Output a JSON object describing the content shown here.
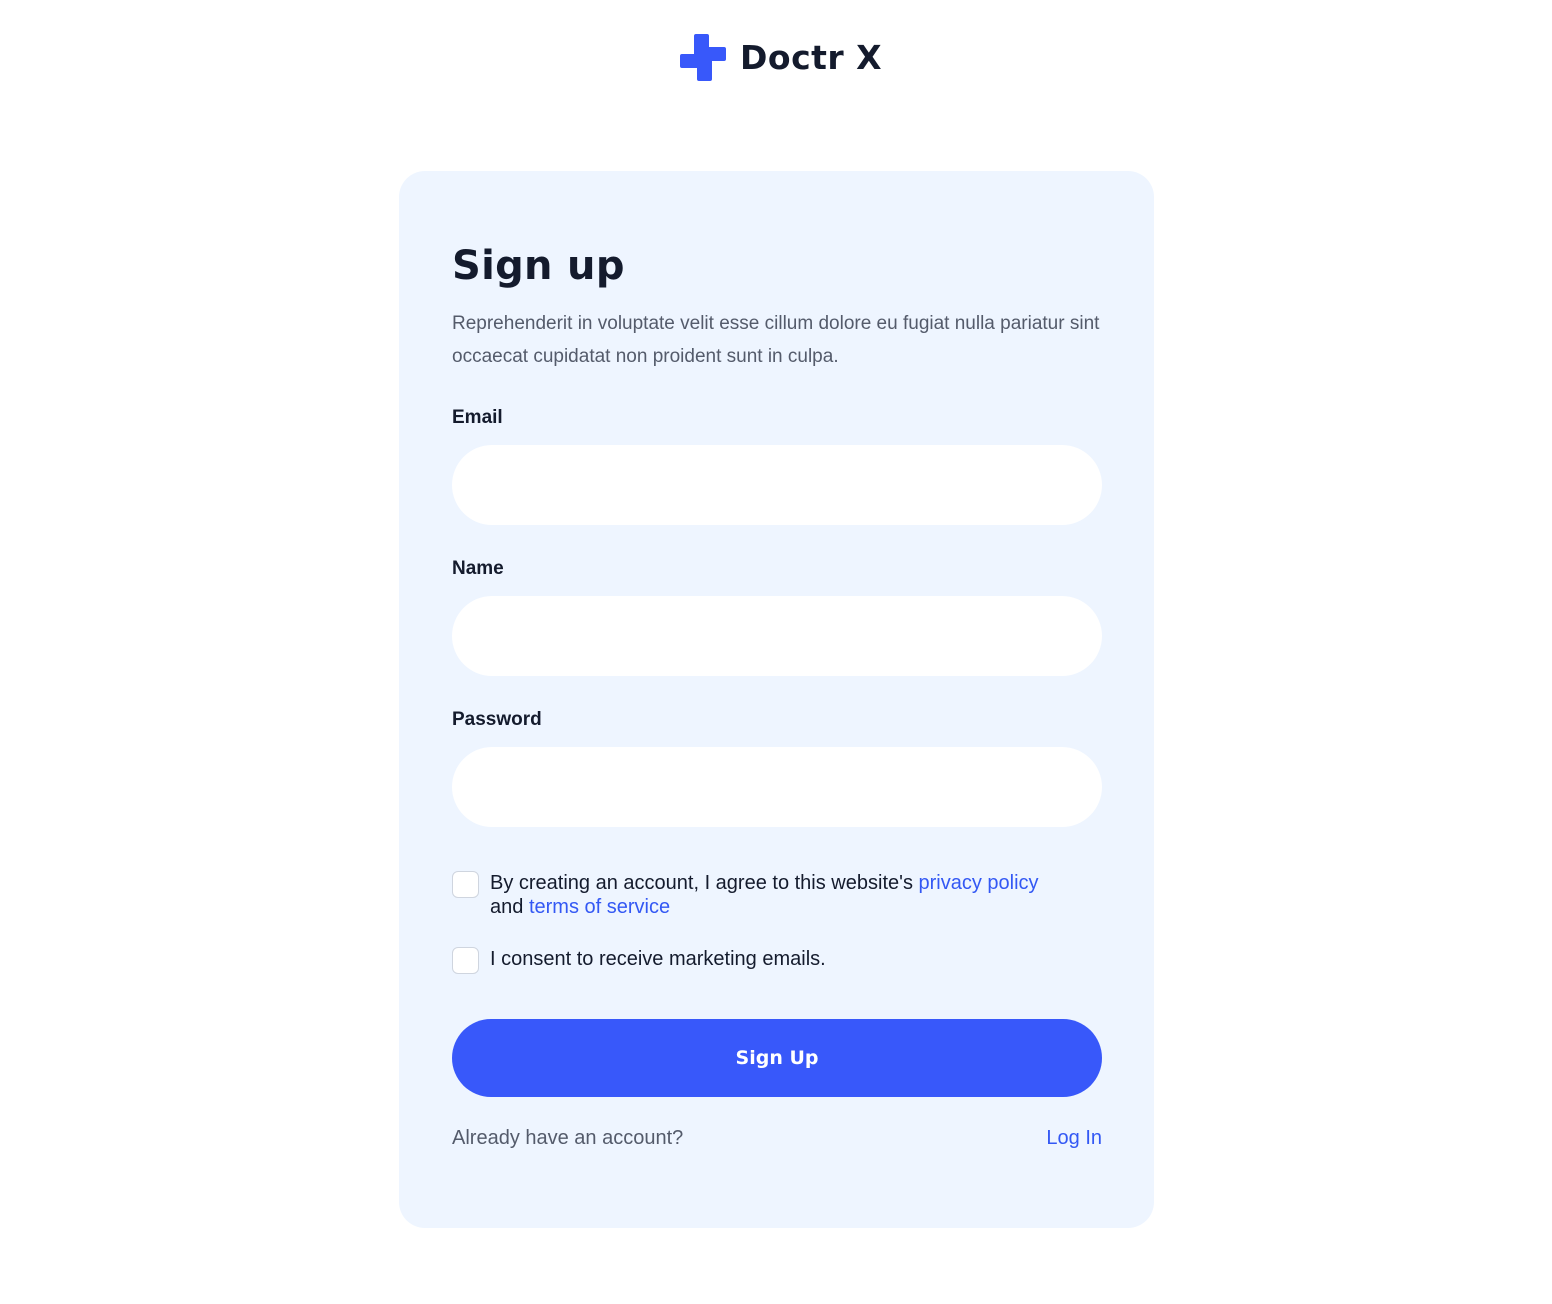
{
  "brand": {
    "name": "Doctr X",
    "icon": "medical-cross-icon",
    "color": "#3858fa"
  },
  "form": {
    "title": "Sign up",
    "description": "Reprehenderit in voluptate velit esse cillum dolore eu fugiat nulla pariatur sint occaecat cupidatat non proident sunt in culpa.",
    "fields": {
      "email": {
        "label": "Email",
        "value": "",
        "placeholder": ""
      },
      "name": {
        "label": "Name",
        "value": "",
        "placeholder": ""
      },
      "password": {
        "label": "Password",
        "value": "",
        "placeholder": ""
      }
    },
    "terms": {
      "text_before": "By creating an account, I agree to this website's ",
      "privacy_link": "privacy policy",
      "text_middle": " and ",
      "terms_link": "terms of service",
      "checked": false
    },
    "marketing": {
      "text": "I consent to receive marketing emails.",
      "checked": false
    },
    "submit_label": "Sign Up",
    "login_prompt": "Already have an account?",
    "login_link": "Log In"
  },
  "colors": {
    "accent": "#3858fa",
    "link": "#3358f4",
    "card_background": "#eef5ff",
    "text_primary": "#141b2d",
    "text_secondary": "#545b6b"
  }
}
